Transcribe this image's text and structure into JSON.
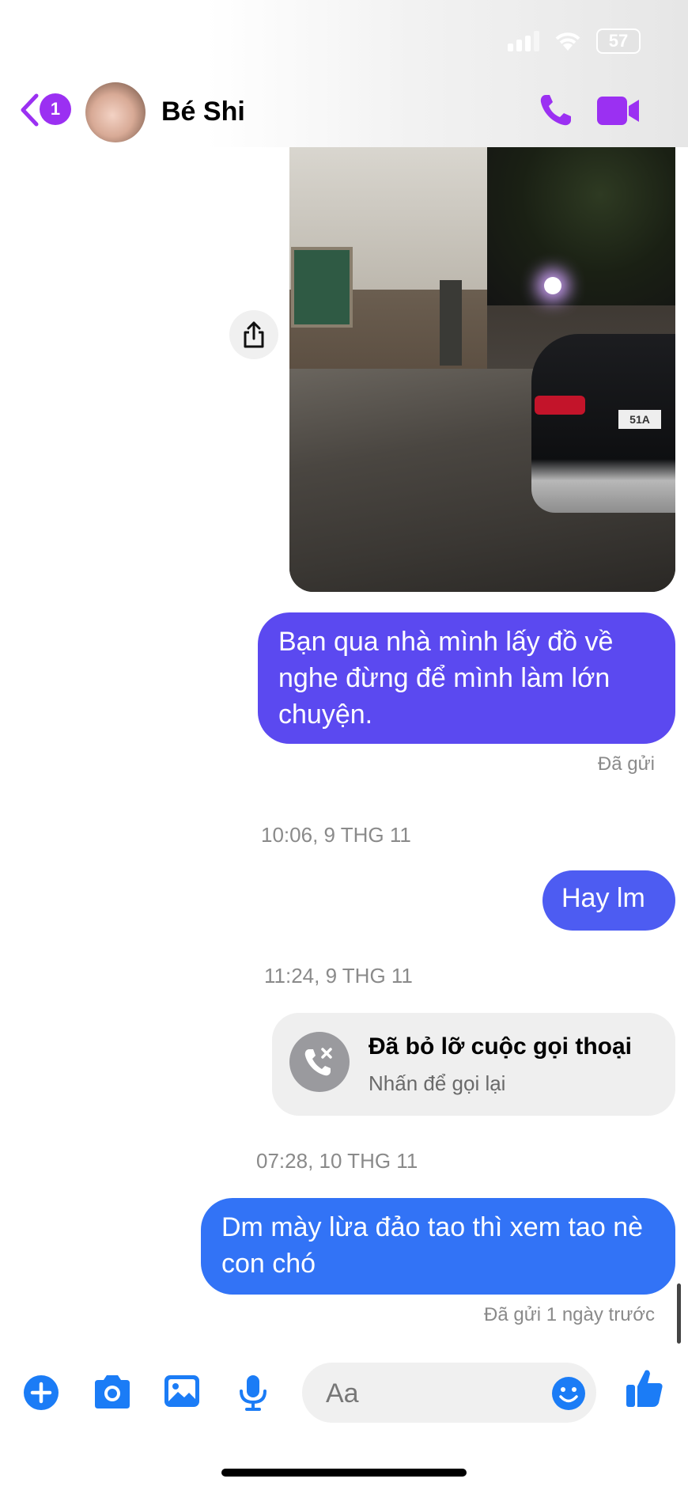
{
  "colors": {
    "header_accent": "#9b30f2",
    "bubble_1": "#5b49f0",
    "bubble_2": "#4d5cf2",
    "bubble_3": "#3273f6",
    "composer_accent": "#1b7cf6"
  },
  "status_bar": {
    "battery": "57"
  },
  "header": {
    "unread_count": "1",
    "contact_name": "Bé Shi",
    "icons": [
      "back-chevron-icon",
      "phone-icon",
      "video-camera-icon"
    ]
  },
  "photo_message": {
    "plate_text": "51A",
    "share_icon": "share-icon"
  },
  "messages": [
    {
      "text": "Bạn qua nhà mình lấy đồ về nghe đừng để mình làm lớn chuyện.",
      "status": "Đã gửi"
    },
    {
      "timestamp": "10:06, 9 THG 11"
    },
    {
      "text": "Hay lm"
    },
    {
      "timestamp": "11:24, 9 THG 11"
    },
    {
      "missed_call_title": "Đã bỏ lỡ cuộc gọi thoại",
      "missed_call_sub": "Nhấn để gọi lại"
    },
    {
      "timestamp": "07:28, 10 THG 11"
    },
    {
      "text": "Dm mày lừa đảo tao thì xem tao nè con chó",
      "status": "Đã gửi 1 ngày trước"
    }
  ],
  "composer": {
    "placeholder": "Aa",
    "icons": [
      "plus-icon",
      "camera-icon",
      "gallery-icon",
      "microphone-icon",
      "emoji-icon",
      "thumbs-up-icon"
    ]
  }
}
